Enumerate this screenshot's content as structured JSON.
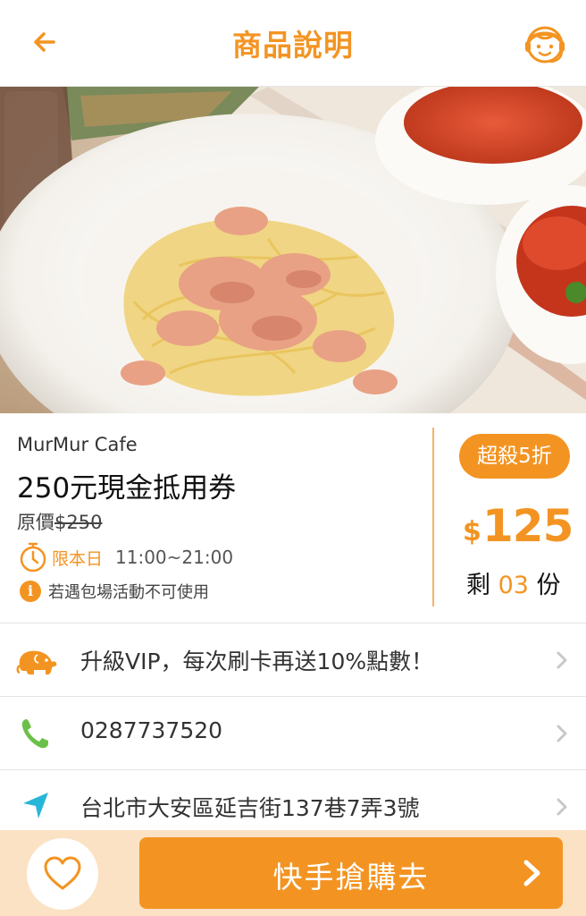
{
  "header": {
    "title": "商品說明"
  },
  "product": {
    "store": "MurMur Cafe",
    "name": "250元現金抵用券",
    "original_price_label": "原價",
    "original_price": "$250",
    "availability_label": "限本日",
    "hours": "11:00~21:00",
    "notice": "若遇包場活動不可使用",
    "badge": "超殺5折",
    "currency": "$",
    "price": "125",
    "remaining_prefix": "剩",
    "remaining_qty": "03",
    "remaining_suffix": "份"
  },
  "rows": [
    {
      "icon": "elephant-icon",
      "text": "升級VIP，每次刷卡再送10%點數！"
    },
    {
      "icon": "phone-icon",
      "text": "0287737520"
    },
    {
      "icon": "location-arrow-icon",
      "text": "台北市大安區延吉街137巷7弄3號"
    }
  ],
  "bottom": {
    "buy_label": "快手搶購去"
  },
  "colors": {
    "accent": "#f39422",
    "bottom_bar": "#fbe2c4",
    "phone_green": "#6cc04a",
    "location_teal": "#27b6d8"
  }
}
